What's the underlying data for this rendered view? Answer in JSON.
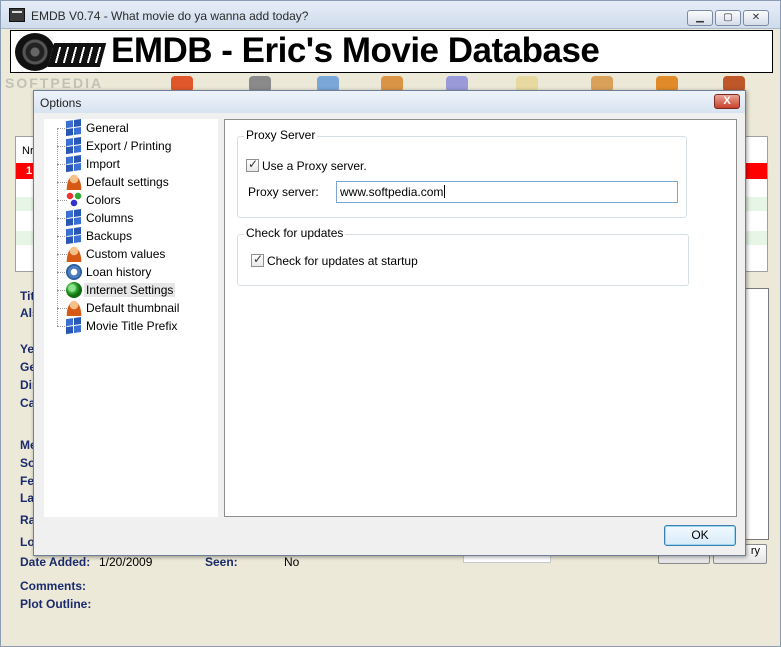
{
  "window": {
    "title": "EMDB V0.74 - What movie do ya wanna add today?",
    "banner_text": "EMDB - Eric's Movie Database",
    "watermark": "SOFTPEDIA"
  },
  "background": {
    "list_header": "Nr",
    "first_row_number": "1",
    "labels": {
      "title": "Tit",
      "also": "Als",
      "year": "Ye",
      "genre": "Ge",
      "director": "Dir",
      "cast": "Ca",
      "media": "Me",
      "sound": "So",
      "features": "Fe",
      "language": "La",
      "rating": "Ra",
      "location": "Lo",
      "date_added": "Date Added:",
      "seen": "Seen:",
      "comments": "Comments:",
      "plot_outline": "Plot Outline:"
    },
    "values": {
      "date_added": "1/20/2009",
      "seen": "No"
    },
    "right_button_label": "ry"
  },
  "dialog": {
    "title": "Options",
    "close_label": "X",
    "tree": [
      {
        "label": "General",
        "icon": "windows-flag-icon"
      },
      {
        "label": "Export / Printing",
        "icon": "windows-flag-icon"
      },
      {
        "label": "Import",
        "icon": "windows-flag-icon"
      },
      {
        "label": "Default settings",
        "icon": "person-icon"
      },
      {
        "label": "Colors",
        "icon": "colors-icon"
      },
      {
        "label": "Columns",
        "icon": "windows-flag-icon"
      },
      {
        "label": "Backups",
        "icon": "windows-flag-icon"
      },
      {
        "label": "Custom values",
        "icon": "person-icon"
      },
      {
        "label": "Loan history",
        "icon": "gear-icon"
      },
      {
        "label": "Internet Settings",
        "icon": "globe-icon",
        "selected": true
      },
      {
        "label": "Default thumbnail",
        "icon": "person-icon"
      },
      {
        "label": "Movie Title Prefix",
        "icon": "windows-flag-icon"
      }
    ],
    "proxy_group": {
      "legend": "Proxy Server",
      "use_proxy_label": "Use a Proxy server.",
      "use_proxy_checked": true,
      "server_label": "Proxy server:",
      "server_value": "www.softpedia.com"
    },
    "updates_group": {
      "legend": "Check for updates",
      "check_label": "Check for updates at startup",
      "check_checked": true
    },
    "ok_label": "OK"
  }
}
